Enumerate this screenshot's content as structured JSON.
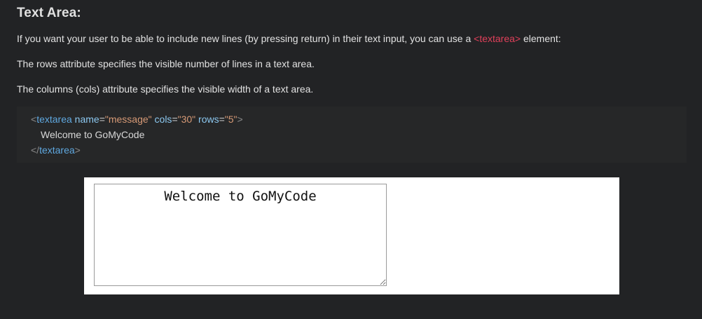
{
  "heading": "Text Area:",
  "paragraphs": {
    "p1_before": "If you want your user to be able to include new lines (by pressing return) in their text input, you can use a ",
    "p1_code": "<textarea>",
    "p1_after": " element:",
    "p2": "The rows attribute specifies the visible number of lines in a text area.",
    "p3": "The columns (cols) attribute specifies the visible width of a text area."
  },
  "code": {
    "open_lt": "<",
    "tag_name": "textarea",
    "attr_name": "name",
    "eq": "=",
    "name_value": "\"message\"",
    "attr_cols": "cols",
    "cols_value": "\"30\"",
    "attr_rows": "rows",
    "rows_value": "\"5\"",
    "open_gt": ">",
    "content": "Welcome to GoMyCode",
    "close_lt": "</",
    "close_tag_name": "textarea",
    "close_gt": ">"
  },
  "demo": {
    "textarea_value": "Welcome to GoMyCode"
  },
  "colors": {
    "background": "#222325",
    "code_background": "#262728",
    "inline_code": "#e0405a",
    "tag": "#5fa8e0",
    "attribute": "#8cc8f0",
    "string": "#d79a76"
  }
}
